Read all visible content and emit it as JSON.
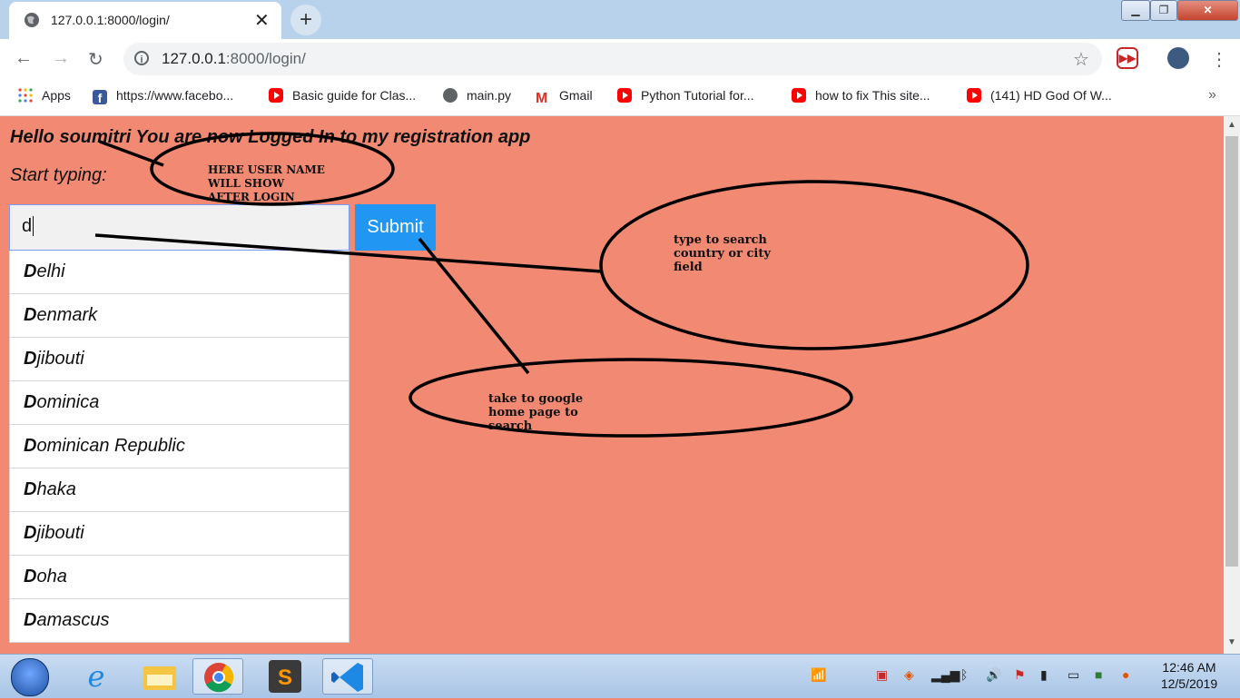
{
  "browser": {
    "tab_title": "127.0.0.1:8000/login/",
    "url_host": "127.0.0.1",
    "url_path": ":8000/login/",
    "new_tab_label": "+",
    "tab_close": "✕"
  },
  "bookmarks": [
    {
      "label": "Apps",
      "icon": "apps-icon"
    },
    {
      "label": "https://www.facebo...",
      "icon": "facebook-icon"
    },
    {
      "label": "Basic guide for Clas...",
      "icon": "youtube-icon"
    },
    {
      "label": "main.py",
      "icon": "globe-icon"
    },
    {
      "label": "Gmail",
      "icon": "gmail-icon"
    },
    {
      "label": "Python Tutorial for...",
      "icon": "youtube-icon"
    },
    {
      "label": "how to fix This site...",
      "icon": "youtube-icon"
    },
    {
      "label": "(141) HD God Of W...",
      "icon": "youtube-icon"
    }
  ],
  "bookmarks_more": "»",
  "page": {
    "greeting": "Hello soumitri You are now Logged In to my registration app",
    "start_label": "Start typing:",
    "search_value": "d",
    "submit_label": "Submit",
    "suggestions": [
      {
        "match": "D",
        "rest": "elhi"
      },
      {
        "match": "D",
        "rest": "enmark"
      },
      {
        "match": "D",
        "rest": "jibouti"
      },
      {
        "match": "D",
        "rest": "ominica"
      },
      {
        "match": "D",
        "rest": "ominican Republic"
      },
      {
        "match": "D",
        "rest": "haka"
      },
      {
        "match": "D",
        "rest": "jibouti"
      },
      {
        "match": "D",
        "rest": "oha"
      },
      {
        "match": "D",
        "rest": "amascus"
      }
    ]
  },
  "annotations": {
    "username": [
      "HERE USER NAME",
      "WILL SHOW",
      "AFTER LOGIN"
    ],
    "search": [
      "type to search",
      "country or city",
      "field"
    ],
    "google": [
      "take to google",
      "home page to",
      "search"
    ]
  },
  "taskbar": {
    "time": "12:46 AM",
    "date": "12/5/2019"
  },
  "colors": {
    "page_background": "#f28a73",
    "submit_button": "#2196f3"
  }
}
